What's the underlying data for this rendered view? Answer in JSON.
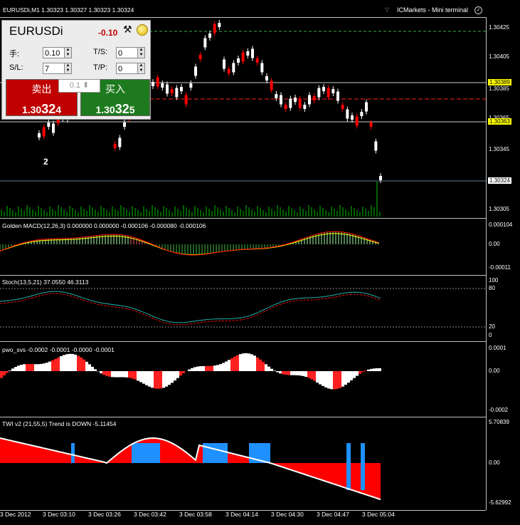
{
  "window": {
    "title": "EURUSDi,M1  1.30323 1.30327 1.30323 1.30324",
    "broker": "ICMarkets - Mini terminal"
  },
  "trade_panel": {
    "symbol": "EURUSDi",
    "change": "-0.10",
    "lots_label": "手:",
    "lots_value": "0.10",
    "ts_label": "T/S:",
    "ts_value": "0",
    "sl_label": "S/L:",
    "sl_value": "7",
    "tp_label": "T/P:",
    "tp_value": "0",
    "sell_label": "卖出",
    "sell_price_main": "1.30",
    "sell_price_big": "32",
    "sell_price_tail": "4",
    "buy_label": "买入",
    "buy_price_main": "1.30",
    "buy_price_big": "32",
    "buy_price_tail": "5",
    "lot_step": "0.1"
  },
  "main_chart": {
    "y_labels": [
      "1.30425",
      "1.30405",
      "1.30385",
      "1.30365",
      "1.30345",
      "1.30324",
      "1.30305"
    ],
    "highlight_labels": [
      "1.30389",
      "1.30363",
      "1.30324"
    ],
    "marker": "2"
  },
  "macd": {
    "label": "Golden MACD(12,26,3) 0.000000 0.000000 -0.000106 -0.000080 -0.000106",
    "y_labels": [
      "0.000104",
      "0.00",
      "-0.00011"
    ]
  },
  "stoch": {
    "label": "Stoch(13,5,21) 37.0550 46.3113",
    "y_labels": [
      "100",
      "80",
      "20",
      "0"
    ]
  },
  "pwo": {
    "label": "pwo_svs -0.0002 -0.0001 -0.0000 -0.0001",
    "y_labels": [
      "0.0001",
      "0.00",
      "-0.0002"
    ]
  },
  "twi": {
    "label": "TWI v2 (21,55,5) Trend is DOWN -5.11454",
    "y_labels": [
      "5.70839",
      "0.00",
      "-5.62992"
    ]
  },
  "x_labels": [
    "3 Dec 2012",
    "3 Dec 03:10",
    "3 Dec 03:26",
    "3 Dec 03:42",
    "3 Dec 03:58",
    "3 Dec 04:14",
    "3 Dec 04:30",
    "3 Dec 04:47",
    "3 Dec 05:04"
  ],
  "colors": {
    "bull": "#ffffff",
    "bear": "#ff0000",
    "volume": "#00c000",
    "macd_line": "#ff0000",
    "signal": "#ffff00",
    "stoch_main": "#20b2aa",
    "stoch_signal": "#ff0000",
    "twi_blue": "#1e90ff"
  }
}
